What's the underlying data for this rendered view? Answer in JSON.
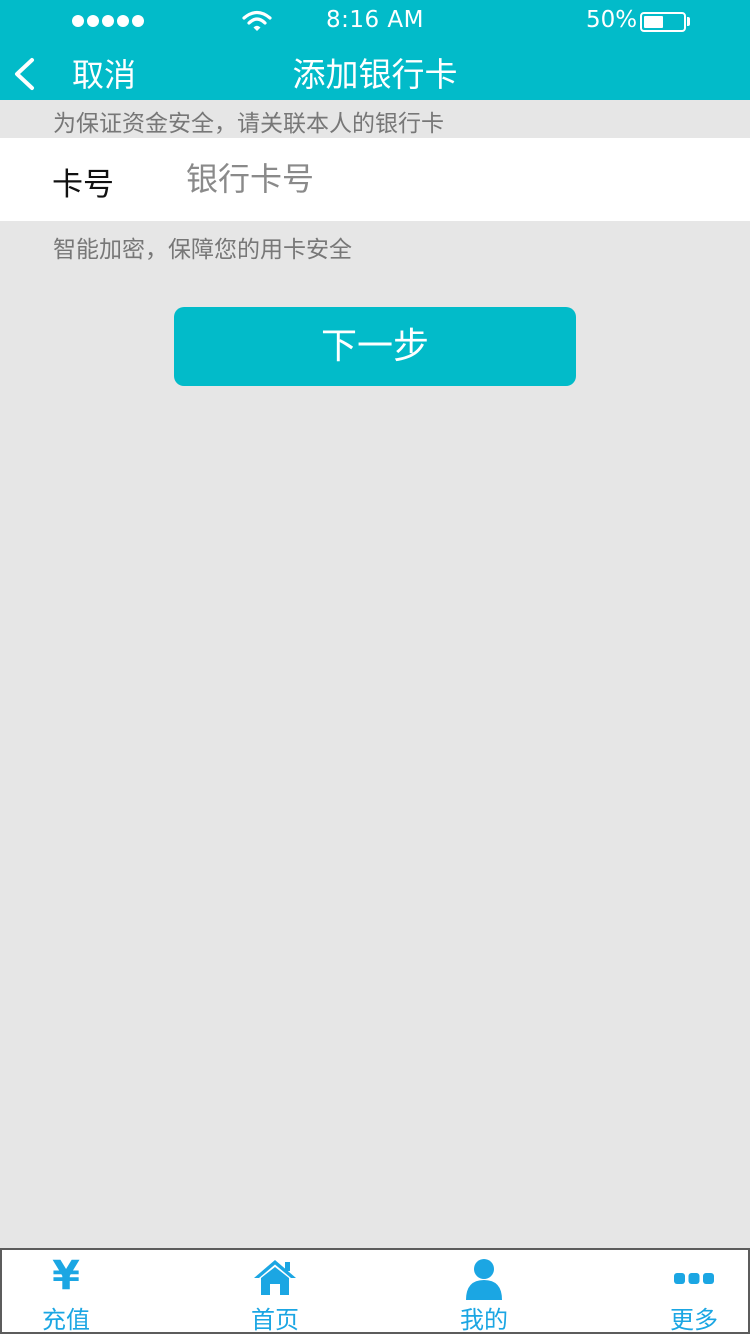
{
  "status_bar": {
    "time": "8:16 AM",
    "battery_percent": "50%",
    "battery_level": 0.5,
    "signal_bars": 5
  },
  "nav": {
    "back_icon": "chevron-left-icon",
    "cancel_label": "取消",
    "title": "添加银行卡"
  },
  "form": {
    "security_hint": "为保证资金安全，请关联本人的银行卡",
    "card_label": "卡号",
    "card_placeholder": "银行卡号",
    "card_value": "",
    "encryption_hint": "智能加密，保障您的用卡安全",
    "next_label": "下一步"
  },
  "tab_bar": {
    "items": [
      {
        "label": "充值",
        "icon": "yen-icon",
        "glyph": "¥"
      },
      {
        "label": "首页",
        "icon": "home-icon"
      },
      {
        "label": "我的",
        "icon": "user-icon"
      },
      {
        "label": "更多",
        "icon": "more-dots-icon"
      }
    ]
  },
  "colors": {
    "brand": "#02bbc9",
    "tab_blue": "#1ba6e3",
    "background": "#e6e6e6"
  }
}
